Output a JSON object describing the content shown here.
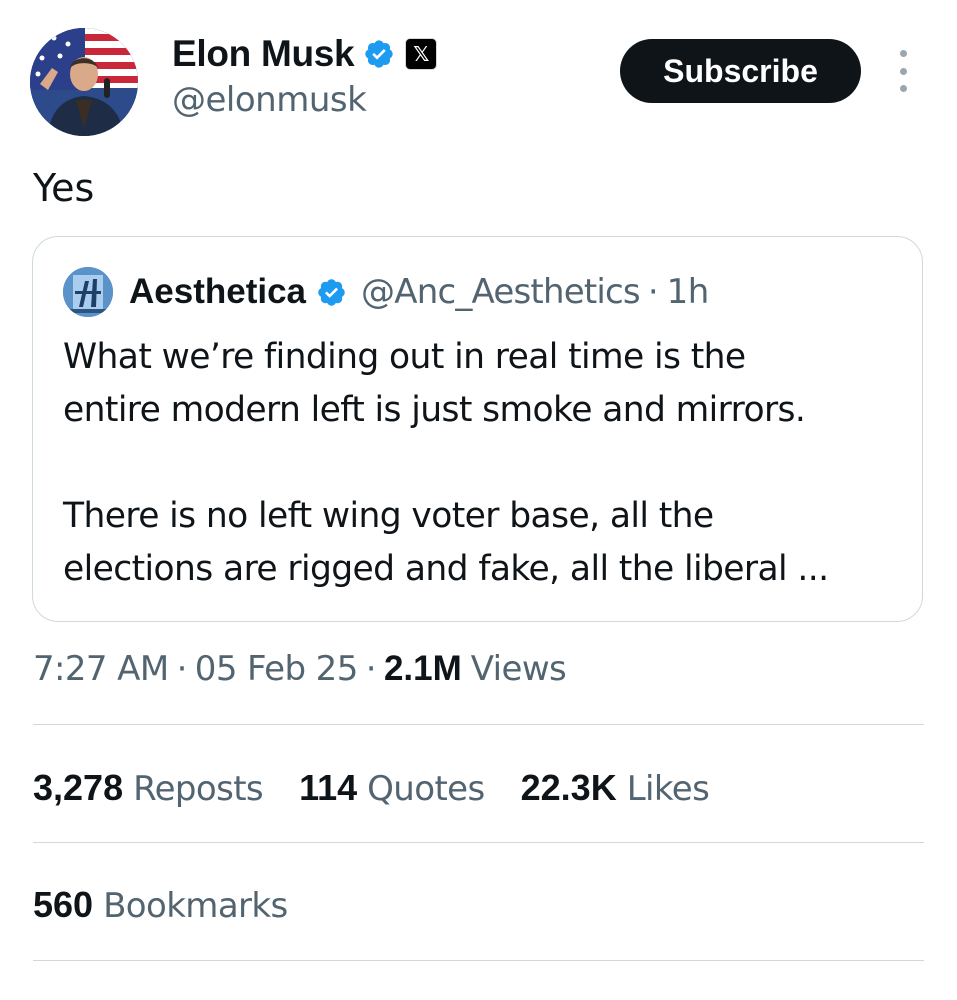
{
  "author": {
    "name": "Elon Musk",
    "handle": "@elonmusk",
    "affiliate_badge_glyph": "𝕏",
    "verified_icon": "verified-badge-icon",
    "verified_color": "#1d9bf0"
  },
  "actions": {
    "subscribe_label": "Subscribe",
    "more_icon": "vertical-ellipsis-icon"
  },
  "tweet": {
    "text": "Yes"
  },
  "quote": {
    "author_name": "Aesthetica",
    "author_handle": "@Anc_Aesthetics",
    "separator": "·",
    "time": "1h",
    "lines": [
      "What we’re finding out in real time is the",
      "entire modern left is just smoke and mirrors.",
      "There is no left wing voter base, all the",
      "elections are rigged and fake, all the liberal ..."
    ]
  },
  "meta": {
    "time": "7:27 AM",
    "separator": "·",
    "date": "05 Feb 25",
    "views_count": "2.1M",
    "views_label": "Views"
  },
  "stats": {
    "reposts": {
      "count": "3,278",
      "label": "Reposts"
    },
    "quotes": {
      "count": "114",
      "label": "Quotes"
    },
    "likes": {
      "count": "22.3K",
      "label": "Likes"
    },
    "bookmarks": {
      "count": "560",
      "label": "Bookmarks"
    }
  },
  "colors": {
    "text_primary": "#0f1419",
    "text_secondary": "#536471",
    "border": "#cfd9de",
    "button_bg": "#0f1419"
  }
}
